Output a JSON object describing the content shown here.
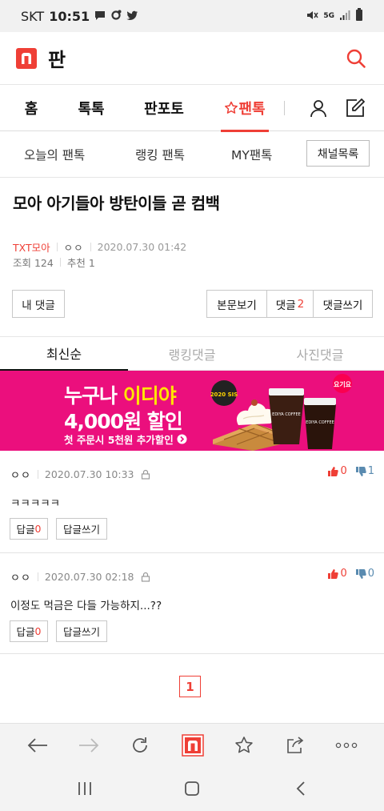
{
  "status_bar": {
    "carrier": "SKT",
    "time": "10:51",
    "network": "5G"
  },
  "header": {
    "brand": "판"
  },
  "main_nav": {
    "tabs": [
      {
        "label": "홈"
      },
      {
        "label": "톡톡"
      },
      {
        "label": "판포토"
      },
      {
        "label": "팬톡",
        "active": true
      }
    ]
  },
  "sub_nav": {
    "items": [
      "오늘의 팬톡",
      "랭킹 팬톡",
      "MY팬톡"
    ],
    "channel_button": "채널목록"
  },
  "post": {
    "title": "모아 아기들아 방탄이들 곧 컴백",
    "category": "TXT모아",
    "author": "ㅇㅇ",
    "date": "2020.07.30 01:42",
    "views": "조회 124",
    "likes": "추천 1"
  },
  "actions": {
    "my_comments": "내 댓글",
    "view_post": "본문보기",
    "comments_label": "댓글",
    "comments_count": "2",
    "write_comment": "댓글쓰기"
  },
  "comment_tabs": {
    "latest": "최신순",
    "ranking": "랭킹댓글",
    "photo": "사진댓글"
  },
  "ad": {
    "line1_a": "누구나 ",
    "line1_b": "이디야",
    "line2": "4,000원 할인",
    "line3": "첫 주문시 5천원 추가할인",
    "badge": "2020 SIS",
    "cup_label_1": "EDIYA COFFEE",
    "cup_label_2": "EDIYA COFFEE",
    "sticker": "요기요"
  },
  "comments": [
    {
      "author": "ㅇㅇ",
      "date": "2020.07.30 10:33",
      "text": "ㅋㅋㅋㅋㅋ",
      "up": "0",
      "down": "1",
      "reply_label": "답글",
      "reply_count": "0",
      "write_reply": "답글쓰기"
    },
    {
      "author": "ㅇㅇ",
      "date": "2020.07.30 02:18",
      "text": "이정도 먹금은 다들 가능하지...??",
      "up": "0",
      "down": "0",
      "reply_label": "답글",
      "reply_count": "0",
      "write_reply": "답글쓰기"
    }
  ],
  "pagination": {
    "current": "1"
  },
  "colors": {
    "accent": "#ef3f36",
    "ad_background": "#eb0f7d",
    "ad_highlight": "#ffe600",
    "downvote": "#5a8bb0"
  }
}
